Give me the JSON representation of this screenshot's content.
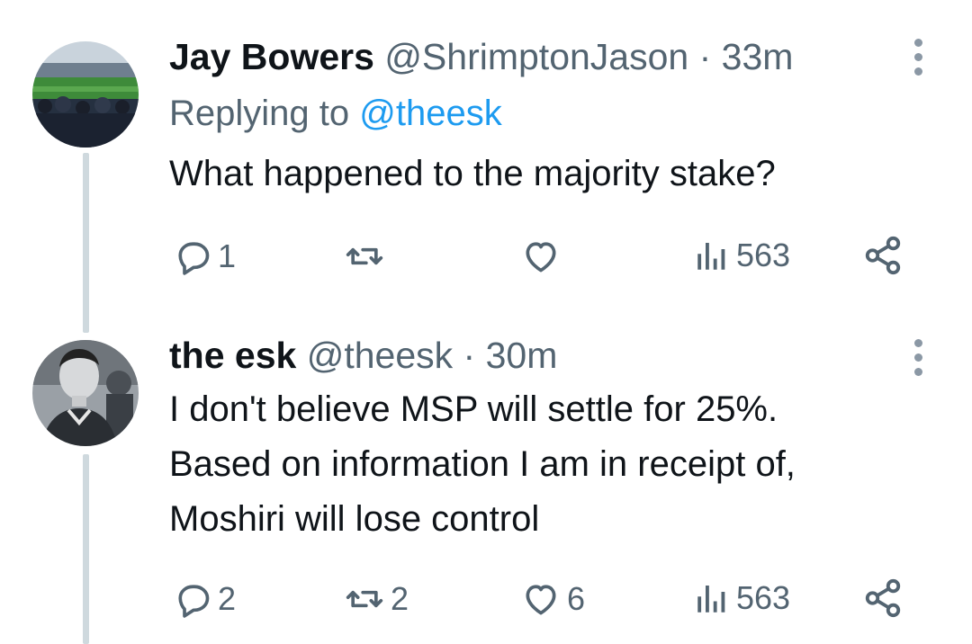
{
  "tweets": [
    {
      "name": "Jay Bowers",
      "handle": "@ShrimptonJason",
      "separator": "·",
      "time": "33m",
      "replying_label": "Replying to",
      "replying_to": "@theesk",
      "text_lines": [
        "What happened to the majority stake?"
      ],
      "actions": {
        "replies": "1",
        "retweets": "",
        "likes": "",
        "views": "563"
      }
    },
    {
      "name": "the esk",
      "handle": "@theesk",
      "separator": "·",
      "time": "30m",
      "text_lines": [
        "I don't believe MSP will settle for 25%.",
        "Based on information I am in receipt of,",
        "Moshiri will lose control"
      ],
      "actions": {
        "replies": "2",
        "retweets": "2",
        "likes": "6",
        "views": "563"
      }
    }
  ],
  "icons": {
    "reply": "speech-bubble",
    "retweet": "retweet-arrows",
    "like": "heart",
    "views": "bar-chart",
    "share": "share-nodes",
    "more": "vertical-ellipsis"
  },
  "colors": {
    "text": "#0f1419",
    "muted": "#536471",
    "link": "#1d9bf0",
    "thread_line": "#cfd9de"
  }
}
